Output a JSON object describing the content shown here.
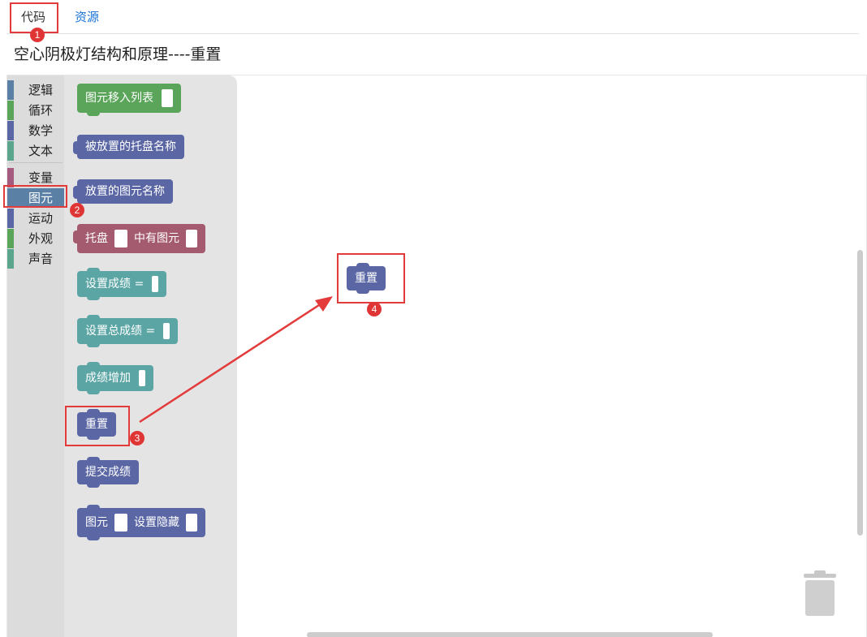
{
  "tabs": [
    {
      "label": "代码"
    },
    {
      "label": "资源"
    }
  ],
  "page_title": "空心阴极灯结构和原理----重置",
  "toolbox": {
    "categories": [
      {
        "label": "逻辑",
        "color": "#5b80a5"
      },
      {
        "label": "循环",
        "color": "#5ba55b"
      },
      {
        "label": "数学",
        "color": "#5b67a5"
      },
      {
        "label": "文本",
        "color": "#5ba58c"
      },
      {
        "label": "变量",
        "color": "#a55b80"
      },
      {
        "label": "图元",
        "color": "#5b80a5",
        "selected": true
      },
      {
        "label": "运动",
        "color": "#5b67a5"
      },
      {
        "label": "外观",
        "color": "#5ba55b"
      },
      {
        "label": "声音",
        "color": "#5ba58c"
      }
    ]
  },
  "flyout": {
    "blocks": [
      {
        "label": "图元移入列表",
        "color": "#5ba55b"
      },
      {
        "label": "被放置的托盘名称",
        "color": "#5b67a5"
      },
      {
        "label": "放置的图元名称",
        "color": "#5b67a5"
      },
      {
        "label": "托盘",
        "label2": "中有图元",
        "color": "#a55b6f"
      },
      {
        "label": "设置成绩 =",
        "color": "#5ba5a5"
      },
      {
        "label": "设置总成绩 =",
        "color": "#5ba5a5"
      },
      {
        "label": "成绩增加",
        "color": "#5ba5a5"
      },
      {
        "label": "重置",
        "color": "#5b67a5"
      },
      {
        "label": "提交成绩",
        "color": "#5b67a5"
      },
      {
        "label": "图元",
        "label2": "设置隐藏",
        "color": "#5b67a5"
      }
    ]
  },
  "canvas": {
    "placed_block": {
      "label": "重置",
      "color": "#5b67a5"
    }
  },
  "annotations": {
    "step1": "1",
    "step2": "2",
    "step3": "3",
    "step4": "4",
    "color": "#e33b3b"
  },
  "icons": {
    "trash": "trash-icon"
  }
}
